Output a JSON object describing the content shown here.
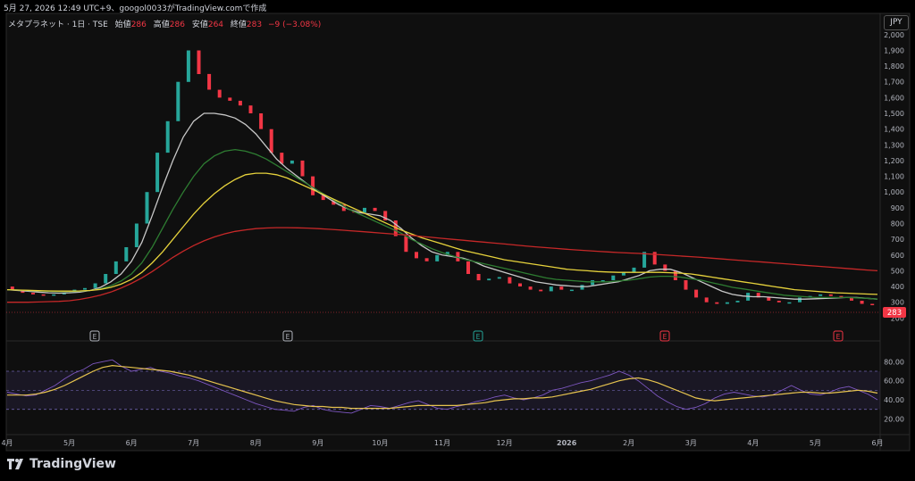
{
  "header": {
    "date_line": "5月 27, 2026 12:49 UTC+9、googol0033がTradingView.comで作成"
  },
  "legend": {
    "symbol": "メタプラネット · 1日 · TSE",
    "open_label": "始値",
    "open": "286",
    "high_label": "高値",
    "high": "286",
    "low_label": "安値",
    "low": "264",
    "close_label": "終値",
    "close": "283",
    "change": "−9 (−3.08%)"
  },
  "currency": "JPY",
  "last_price_tag": "283",
  "footer": {
    "brand": "TradingView"
  },
  "colors": {
    "up": "#26a69a",
    "down": "#f23645",
    "ma_short": "#c8c8c8",
    "ma_mid": "#2e7d32",
    "ma_long": "#e6d23c",
    "ma_200": "#c62828",
    "rsi": "#7e57c2",
    "rsi_ma": "#e6c34f"
  },
  "chart_data": [
    {
      "type": "line",
      "title": "",
      "x_ticks": [
        "4月",
        "5月",
        "6月",
        "7月",
        "8月",
        "9月",
        "10月",
        "11月",
        "12月",
        "2026",
        "2月",
        "3月",
        "4月",
        "5月",
        "6月"
      ],
      "y_ticks": [
        200,
        300,
        400,
        500,
        600,
        700,
        800,
        900,
        1000,
        1100,
        1200,
        1300,
        1400,
        1500,
        1600,
        1700,
        1800,
        1900,
        2000
      ],
      "ylim": [
        100,
        2050
      ],
      "grid": false,
      "events": [
        "E",
        "E",
        "E",
        "E",
        "E"
      ],
      "series": [
        {
          "values": [
            400,
            380,
            360,
            350,
            345,
            350,
            360,
            380,
            390,
            420,
            480,
            560,
            650,
            800,
            1000,
            1250,
            1450,
            1700,
            1900,
            1750,
            1650,
            1600,
            1580,
            1550,
            1500,
            1400,
            1250,
            1180,
            1200,
            1100,
            980,
            950,
            920,
            880,
            870,
            900,
            880,
            820,
            720,
            620,
            580,
            560,
            600,
            620,
            560,
            480,
            440,
            450,
            460,
            420,
            400,
            380,
            370,
            400,
            380,
            380,
            410,
            440,
            440,
            470,
            490,
            520,
            620,
            540,
            500,
            440,
            380,
            330,
            300,
            290,
            300,
            310,
            360,
            330,
            310,
            300,
            300,
            330,
            340,
            350,
            340,
            330,
            310,
            290,
            283
          ]
        },
        {
          "values": [
            380,
            375,
            370,
            365,
            360,
            358,
            360,
            365,
            375,
            395,
            430,
            480,
            560,
            680,
            850,
            1030,
            1200,
            1350,
            1450,
            1500,
            1500,
            1490,
            1470,
            1430,
            1370,
            1290,
            1210,
            1150,
            1100,
            1050,
            1000,
            960,
            920,
            890,
            870,
            860,
            850,
            820,
            770,
            710,
            660,
            620,
            600,
            590,
            580,
            560,
            530,
            510,
            490,
            470,
            450,
            430,
            420,
            410,
            405,
            400,
            400,
            410,
            420,
            430,
            450,
            470,
            500,
            510,
            510,
            490,
            460,
            430,
            400,
            370,
            350,
            340,
            335,
            335,
            330,
            325,
            320,
            320,
            322,
            325,
            328,
            330,
            330,
            325,
            320
          ]
        },
        {
          "values": [
            380,
            378,
            375,
            372,
            370,
            368,
            368,
            370,
            375,
            385,
            405,
            435,
            480,
            550,
            650,
            770,
            890,
            1000,
            1100,
            1180,
            1230,
            1260,
            1270,
            1260,
            1240,
            1210,
            1170,
            1130,
            1090,
            1050,
            1010,
            970,
            930,
            890,
            860,
            830,
            800,
            770,
            740,
            700,
            670,
            640,
            615,
            595,
            575,
            560,
            545,
            530,
            515,
            500,
            485,
            470,
            455,
            445,
            440,
            435,
            430,
            430,
            430,
            435,
            440,
            450,
            460,
            465,
            465,
            460,
            450,
            440,
            425,
            410,
            395,
            385,
            375,
            365,
            355,
            345,
            340,
            335,
            330,
            330,
            330,
            330,
            328,
            325,
            320
          ]
        },
        {
          "values": [
            380,
            378,
            376,
            374,
            372,
            371,
            371,
            372,
            375,
            382,
            395,
            415,
            445,
            490,
            550,
            620,
            700,
            780,
            860,
            930,
            990,
            1040,
            1080,
            1110,
            1120,
            1120,
            1110,
            1090,
            1060,
            1030,
            1000,
            970,
            940,
            910,
            880,
            850,
            820,
            790,
            760,
            735,
            710,
            690,
            670,
            650,
            630,
            615,
            600,
            585,
            570,
            560,
            550,
            540,
            530,
            520,
            510,
            505,
            500,
            495,
            492,
            490,
            490,
            490,
            490,
            490,
            488,
            485,
            480,
            470,
            460,
            450,
            440,
            430,
            420,
            410,
            400,
            390,
            380,
            375,
            370,
            365,
            360,
            358,
            355,
            352,
            350
          ]
        },
        {
          "values": [
            300,
            300,
            300,
            302,
            304,
            306,
            310,
            318,
            330,
            345,
            365,
            390,
            420,
            455,
            495,
            540,
            585,
            625,
            660,
            690,
            715,
            735,
            750,
            760,
            768,
            772,
            774,
            774,
            773,
            771,
            768,
            764,
            760,
            755,
            750,
            745,
            740,
            735,
            730,
            725,
            718,
            712,
            706,
            700,
            694,
            688,
            682,
            676,
            670,
            664,
            658,
            652,
            647,
            642,
            637,
            632,
            628,
            624,
            620,
            616,
            613,
            610,
            606,
            602,
            598,
            594,
            590,
            585,
            580,
            575,
            570,
            565,
            560,
            555,
            550,
            545,
            540,
            535,
            530,
            525,
            520,
            515,
            510,
            505,
            500
          ]
        }
      ]
    },
    {
      "type": "line",
      "title": "",
      "y_ticks": [
        20,
        40,
        60,
        80
      ],
      "ylim": [
        10,
        85
      ],
      "bands": [
        30,
        50,
        70
      ],
      "series": [
        {
          "values": [
            48,
            46,
            44,
            45,
            50,
            55,
            62,
            68,
            72,
            78,
            80,
            82,
            75,
            70,
            72,
            74,
            70,
            68,
            65,
            63,
            60,
            56,
            52,
            48,
            44,
            40,
            36,
            33,
            30,
            29,
            28,
            32,
            34,
            30,
            28,
            27,
            26,
            30,
            34,
            33,
            31,
            34,
            37,
            39,
            35,
            31,
            30,
            33,
            35,
            38,
            40,
            43,
            45,
            42,
            40,
            42,
            45,
            50,
            52,
            55,
            58,
            60,
            63,
            66,
            70,
            66,
            60,
            52,
            44,
            38,
            33,
            30,
            32,
            36,
            42,
            46,
            48,
            46,
            44,
            43,
            45,
            50,
            55,
            50,
            46,
            45,
            48,
            52,
            54,
            50,
            46,
            40
          ]
        },
        {
          "values": [
            45,
            45,
            45,
            46,
            48,
            51,
            55,
            60,
            65,
            70,
            74,
            76,
            75,
            74,
            73,
            72,
            71,
            70,
            68,
            66,
            63,
            60,
            57,
            54,
            51,
            48,
            45,
            42,
            39,
            37,
            35,
            34,
            33,
            33,
            32,
            32,
            31,
            31,
            31,
            31,
            31,
            32,
            33,
            34,
            34,
            34,
            34,
            34,
            35,
            36,
            37,
            39,
            40,
            41,
            41,
            42,
            42,
            43,
            45,
            47,
            49,
            51,
            54,
            57,
            60,
            62,
            63,
            61,
            58,
            54,
            50,
            46,
            42,
            40,
            39,
            40,
            41,
            42,
            43,
            44,
            45,
            46,
            47,
            48,
            48,
            47,
            47,
            48,
            49,
            50,
            49,
            47
          ]
        }
      ]
    }
  ]
}
